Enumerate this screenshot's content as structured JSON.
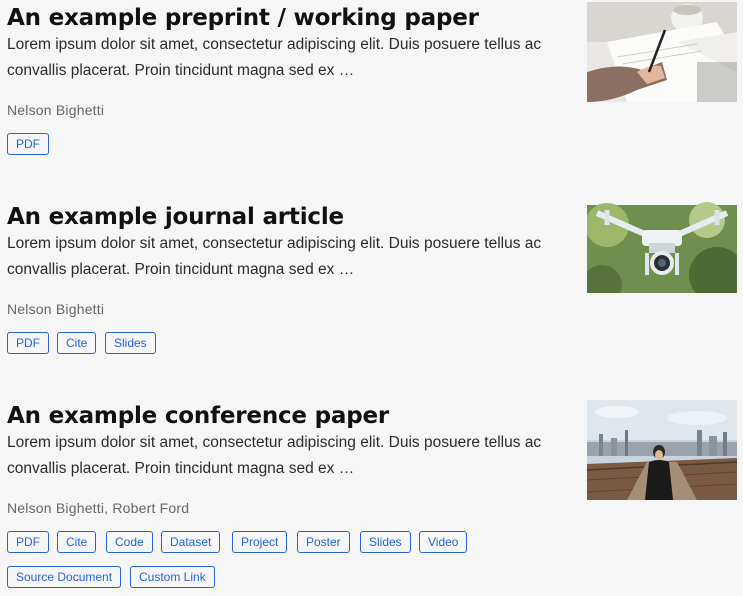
{
  "publications": [
    {
      "title": "An example preprint / working paper",
      "summary": "Lorem ipsum dolor sit amet, consectetur adipiscing elit. Duis posuere tellus ac convallis placerat. Proin tincidunt magna sed ex …",
      "authors": "Nelson Bighetti",
      "links": [
        "PDF"
      ],
      "thumbnail": "person-writing-notebook-icon"
    },
    {
      "title": "An example journal article",
      "summary": "Lorem ipsum dolor sit amet, consectetur adipiscing elit. Duis posuere tellus ac convallis placerat. Proin tincidunt magna sed ex …",
      "authors": "Nelson Bighetti",
      "links": [
        "PDF",
        "Cite",
        "Slides"
      ],
      "thumbnail": "drone-camera-icon"
    },
    {
      "title": "An example conference paper",
      "summary": "Lorem ipsum dolor sit amet, consectetur adipiscing elit. Duis posuere tellus ac convallis placerat. Proin tincidunt magna sed ex …",
      "authors": "Nelson Bighetti, Robert Ford",
      "links": [
        "PDF",
        "Cite",
        "Code",
        "Dataset",
        "Project",
        "Poster",
        "Slides",
        "Video",
        "Source Document",
        "Custom Link"
      ],
      "thumbnail": "city-bridge-person-icon"
    }
  ],
  "colors": {
    "accent": "#2563d6",
    "background": "#f6f6f6",
    "title": "#111111"
  }
}
